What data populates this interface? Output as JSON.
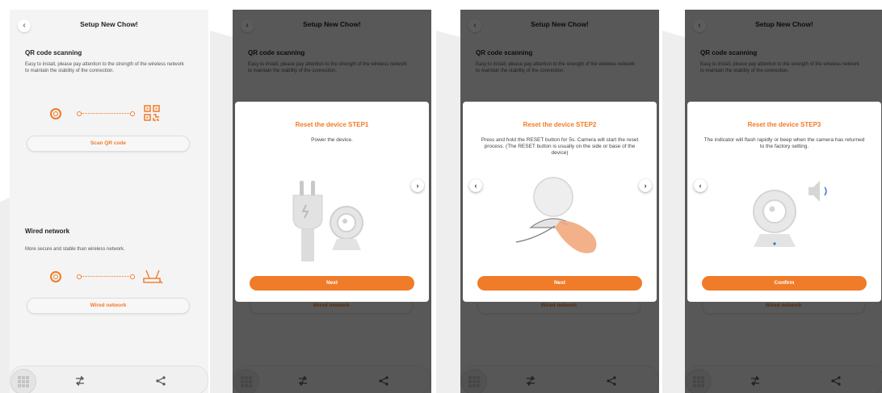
{
  "app": {
    "title": "Setup New Chow!"
  },
  "qr_section": {
    "title": "QR code scanning",
    "description": "Easy to install, please pay attention to the strength of the wireless network to maintain the stability of the connection.",
    "button": "Scan QR code"
  },
  "wired_section": {
    "title": "Wired network",
    "description": "More secure and stable than wireless network.",
    "button": "Wired network"
  },
  "bottom_nav": {
    "icons": [
      "grid-icon",
      "swap-icon",
      "share-icon"
    ]
  },
  "steps": [
    {
      "title": "Reset the device STEP1",
      "text": "Power the device.",
      "button": "Next",
      "show_prev": false,
      "show_next": true,
      "illustration": "plug-and-camera"
    },
    {
      "title": "Reset the device STEP2",
      "text": "Press and hold the RESET button for 5s. Camera will start the reset process. (The RESET button is usually on the side or base of the device)",
      "button": "Next",
      "show_prev": true,
      "show_next": true,
      "illustration": "finger-press-camera-base"
    },
    {
      "title": "Reset the device STEP3",
      "text": "The indicator will flash rapidly or beep when the camera has returned to the factory setting.",
      "button": "Confirm",
      "show_prev": true,
      "show_next": false,
      "illustration": "camera-with-speaker"
    }
  ],
  "colors": {
    "accent": "#f07b28",
    "overlay": "#000000",
    "background": "#f4f4f4"
  },
  "nav_labels": {
    "back": "‹",
    "prev": "‹",
    "next": "›"
  }
}
